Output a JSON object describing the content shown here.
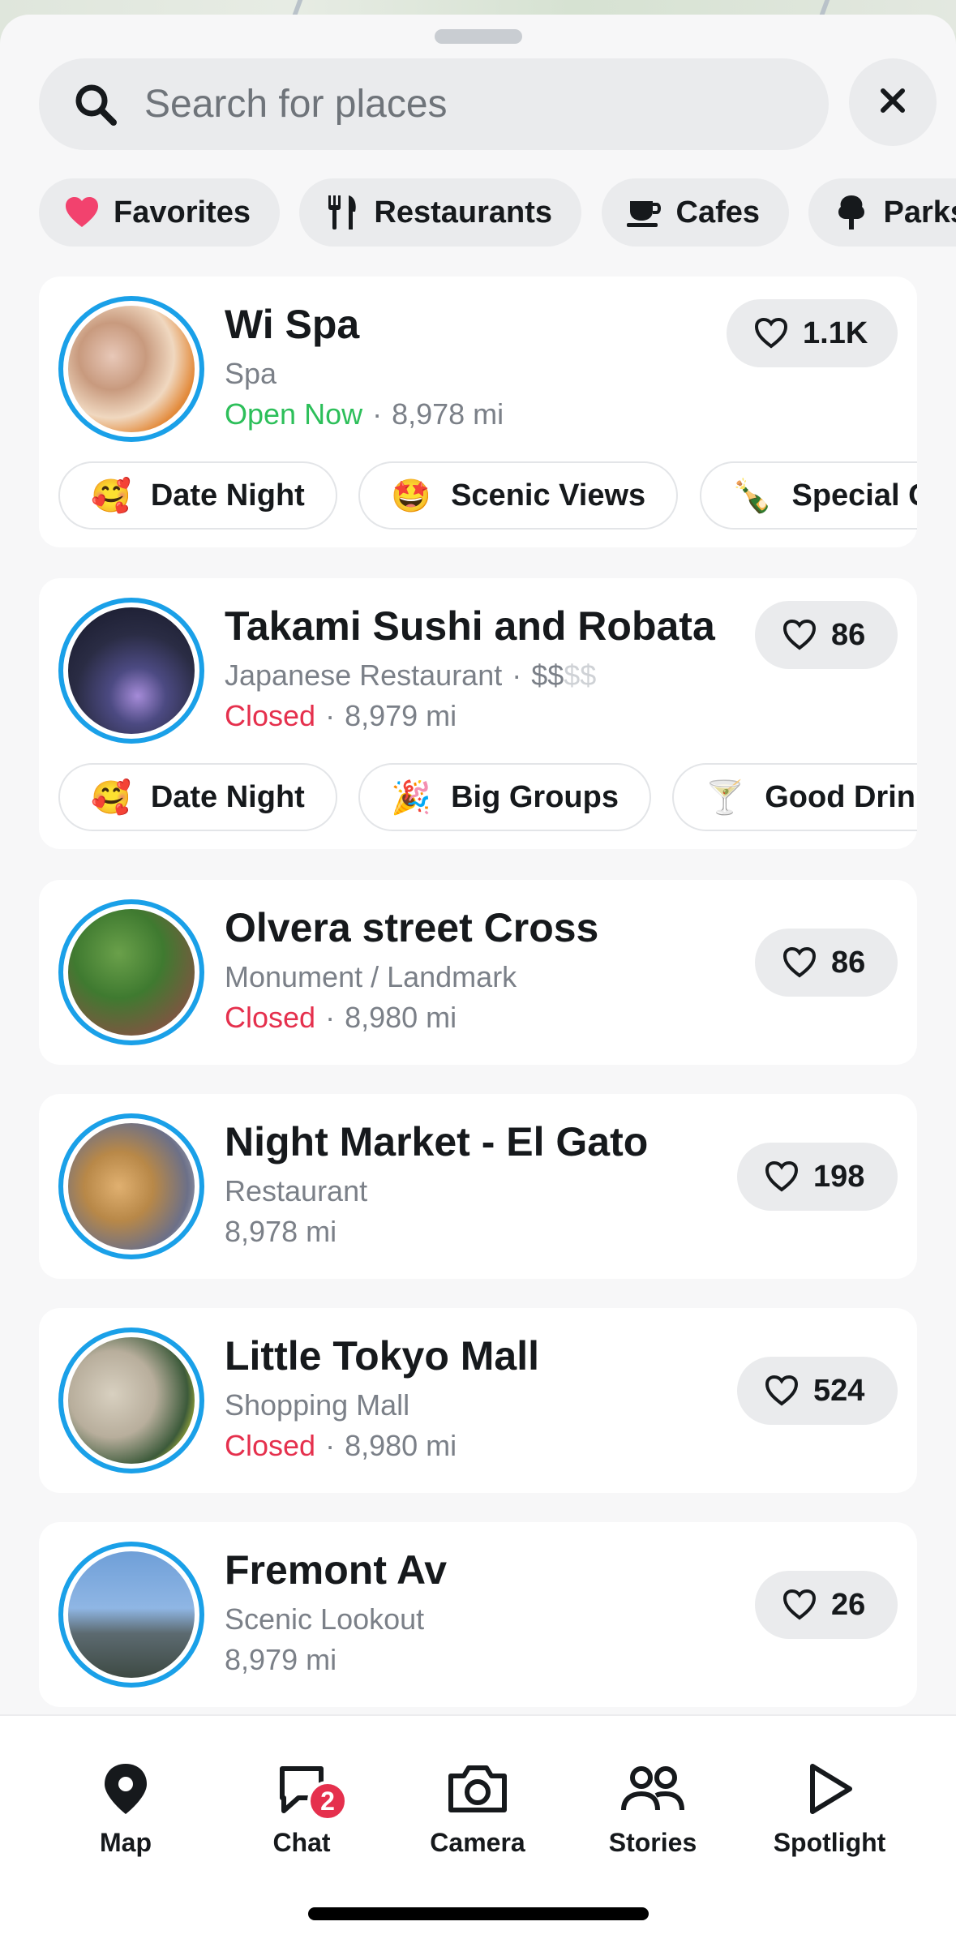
{
  "search": {
    "placeholder": "Search for places"
  },
  "filters": [
    {
      "label": "Favorites",
      "icon": "heart-icon"
    },
    {
      "label": "Restaurants",
      "icon": "fork-knife-icon"
    },
    {
      "label": "Cafes",
      "icon": "coffee-cup-icon"
    },
    {
      "label": "Parks",
      "icon": "tree-icon"
    }
  ],
  "places": [
    {
      "name": "Wi Spa",
      "category": "Spa",
      "status": "Open Now",
      "distance": "8,978 mi",
      "likes": "1.1K",
      "tags": [
        {
          "emoji": "🥰",
          "label": "Date Night"
        },
        {
          "emoji": "🤩",
          "label": "Scenic Views"
        },
        {
          "emoji": "🍾",
          "label": "Special Occasions"
        }
      ]
    },
    {
      "name": "Takami Sushi and Robata",
      "category": "Japanese Restaurant",
      "price": "$$",
      "price_rest": "$$",
      "status": "Closed",
      "distance": "8,979 mi",
      "likes": "86",
      "tags": [
        {
          "emoji": "🥰",
          "label": "Date Night"
        },
        {
          "emoji": "🎉",
          "label": "Big Groups"
        },
        {
          "emoji": "🍸",
          "label": "Good Drinks"
        }
      ]
    },
    {
      "name": "Olvera street Cross",
      "category": "Monument / Landmark",
      "status": "Closed",
      "distance": "8,980 mi",
      "likes": "86"
    },
    {
      "name": "Night Market - El Gato",
      "category": "Restaurant",
      "distance": "8,978 mi",
      "likes": "198"
    },
    {
      "name": "Little Tokyo Mall",
      "category": "Shopping Mall",
      "status": "Closed",
      "distance": "8,980 mi",
      "likes": "524"
    },
    {
      "name": "Fremont Av",
      "category": "Scenic Lookout",
      "distance": "8,979 mi",
      "likes": "26"
    }
  ],
  "nav": {
    "map": "Map",
    "chat": "Chat",
    "chat_badge": "2",
    "camera": "Camera",
    "stories": "Stories",
    "spotlight": "Spotlight"
  },
  "colors": {
    "accent_ring": "#1aa0e8",
    "open": "#2dbf5a",
    "closed": "#e5304d",
    "favorite_heart": "#f2426e"
  }
}
